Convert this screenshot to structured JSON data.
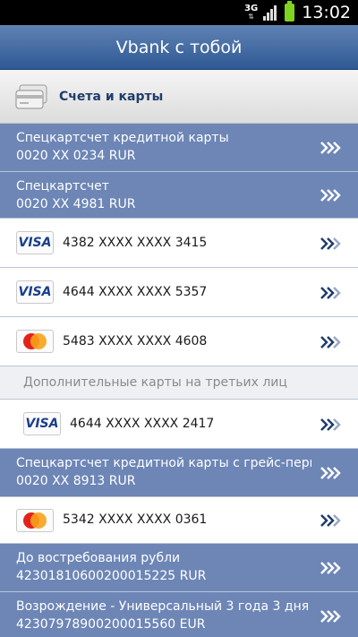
{
  "status_bar": {
    "network": "3G",
    "time": "13:02"
  },
  "header": {
    "title": "Vbank с тобой"
  },
  "section": {
    "label": "Счета и карты",
    "icon": "cards-icon"
  },
  "accounts": [
    {
      "line1": "Спецкартсчет кредитной карты",
      "line2": "0020 XX 0234 RUR"
    },
    {
      "line1": "Спецкартсчет",
      "line2": "0020 XX 4981 RUR"
    }
  ],
  "cards": [
    {
      "brand": "VISA",
      "number": "4382 XXXX XXXX 3415"
    },
    {
      "brand": "VISA",
      "number": "4644 XXXX XXXX 5357"
    },
    {
      "brand": "MasterCard",
      "number": "5483 XXXX XXXX 4608"
    }
  ],
  "third_party": {
    "label": "Дополнительные карты на третьих лиц",
    "cards": [
      {
        "brand": "VISA",
        "number": "4644 XXXX XXXX 2417"
      }
    ]
  },
  "grace_account": {
    "line1": "Спецкартсчет кредитной карты с грейс-пери",
    "line2": "0020 XX 8913 RUR"
  },
  "card_after_grace": {
    "brand": "MasterCard",
    "number": "5342 XXXX XXXX 0361"
  },
  "deposits": [
    {
      "line1": "До востребования рубли",
      "line2": "42301810600200015225 RUR"
    },
    {
      "line1": "Возрождение - Универсальный 3 года 3 дня",
      "line2": "42307978900200015560 EUR"
    }
  ],
  "colors": {
    "header_blue": "#3d6299",
    "row_blue": "#6d86b6",
    "chevron": "#ffffff",
    "chevron_dark": "#1f3d6b"
  }
}
